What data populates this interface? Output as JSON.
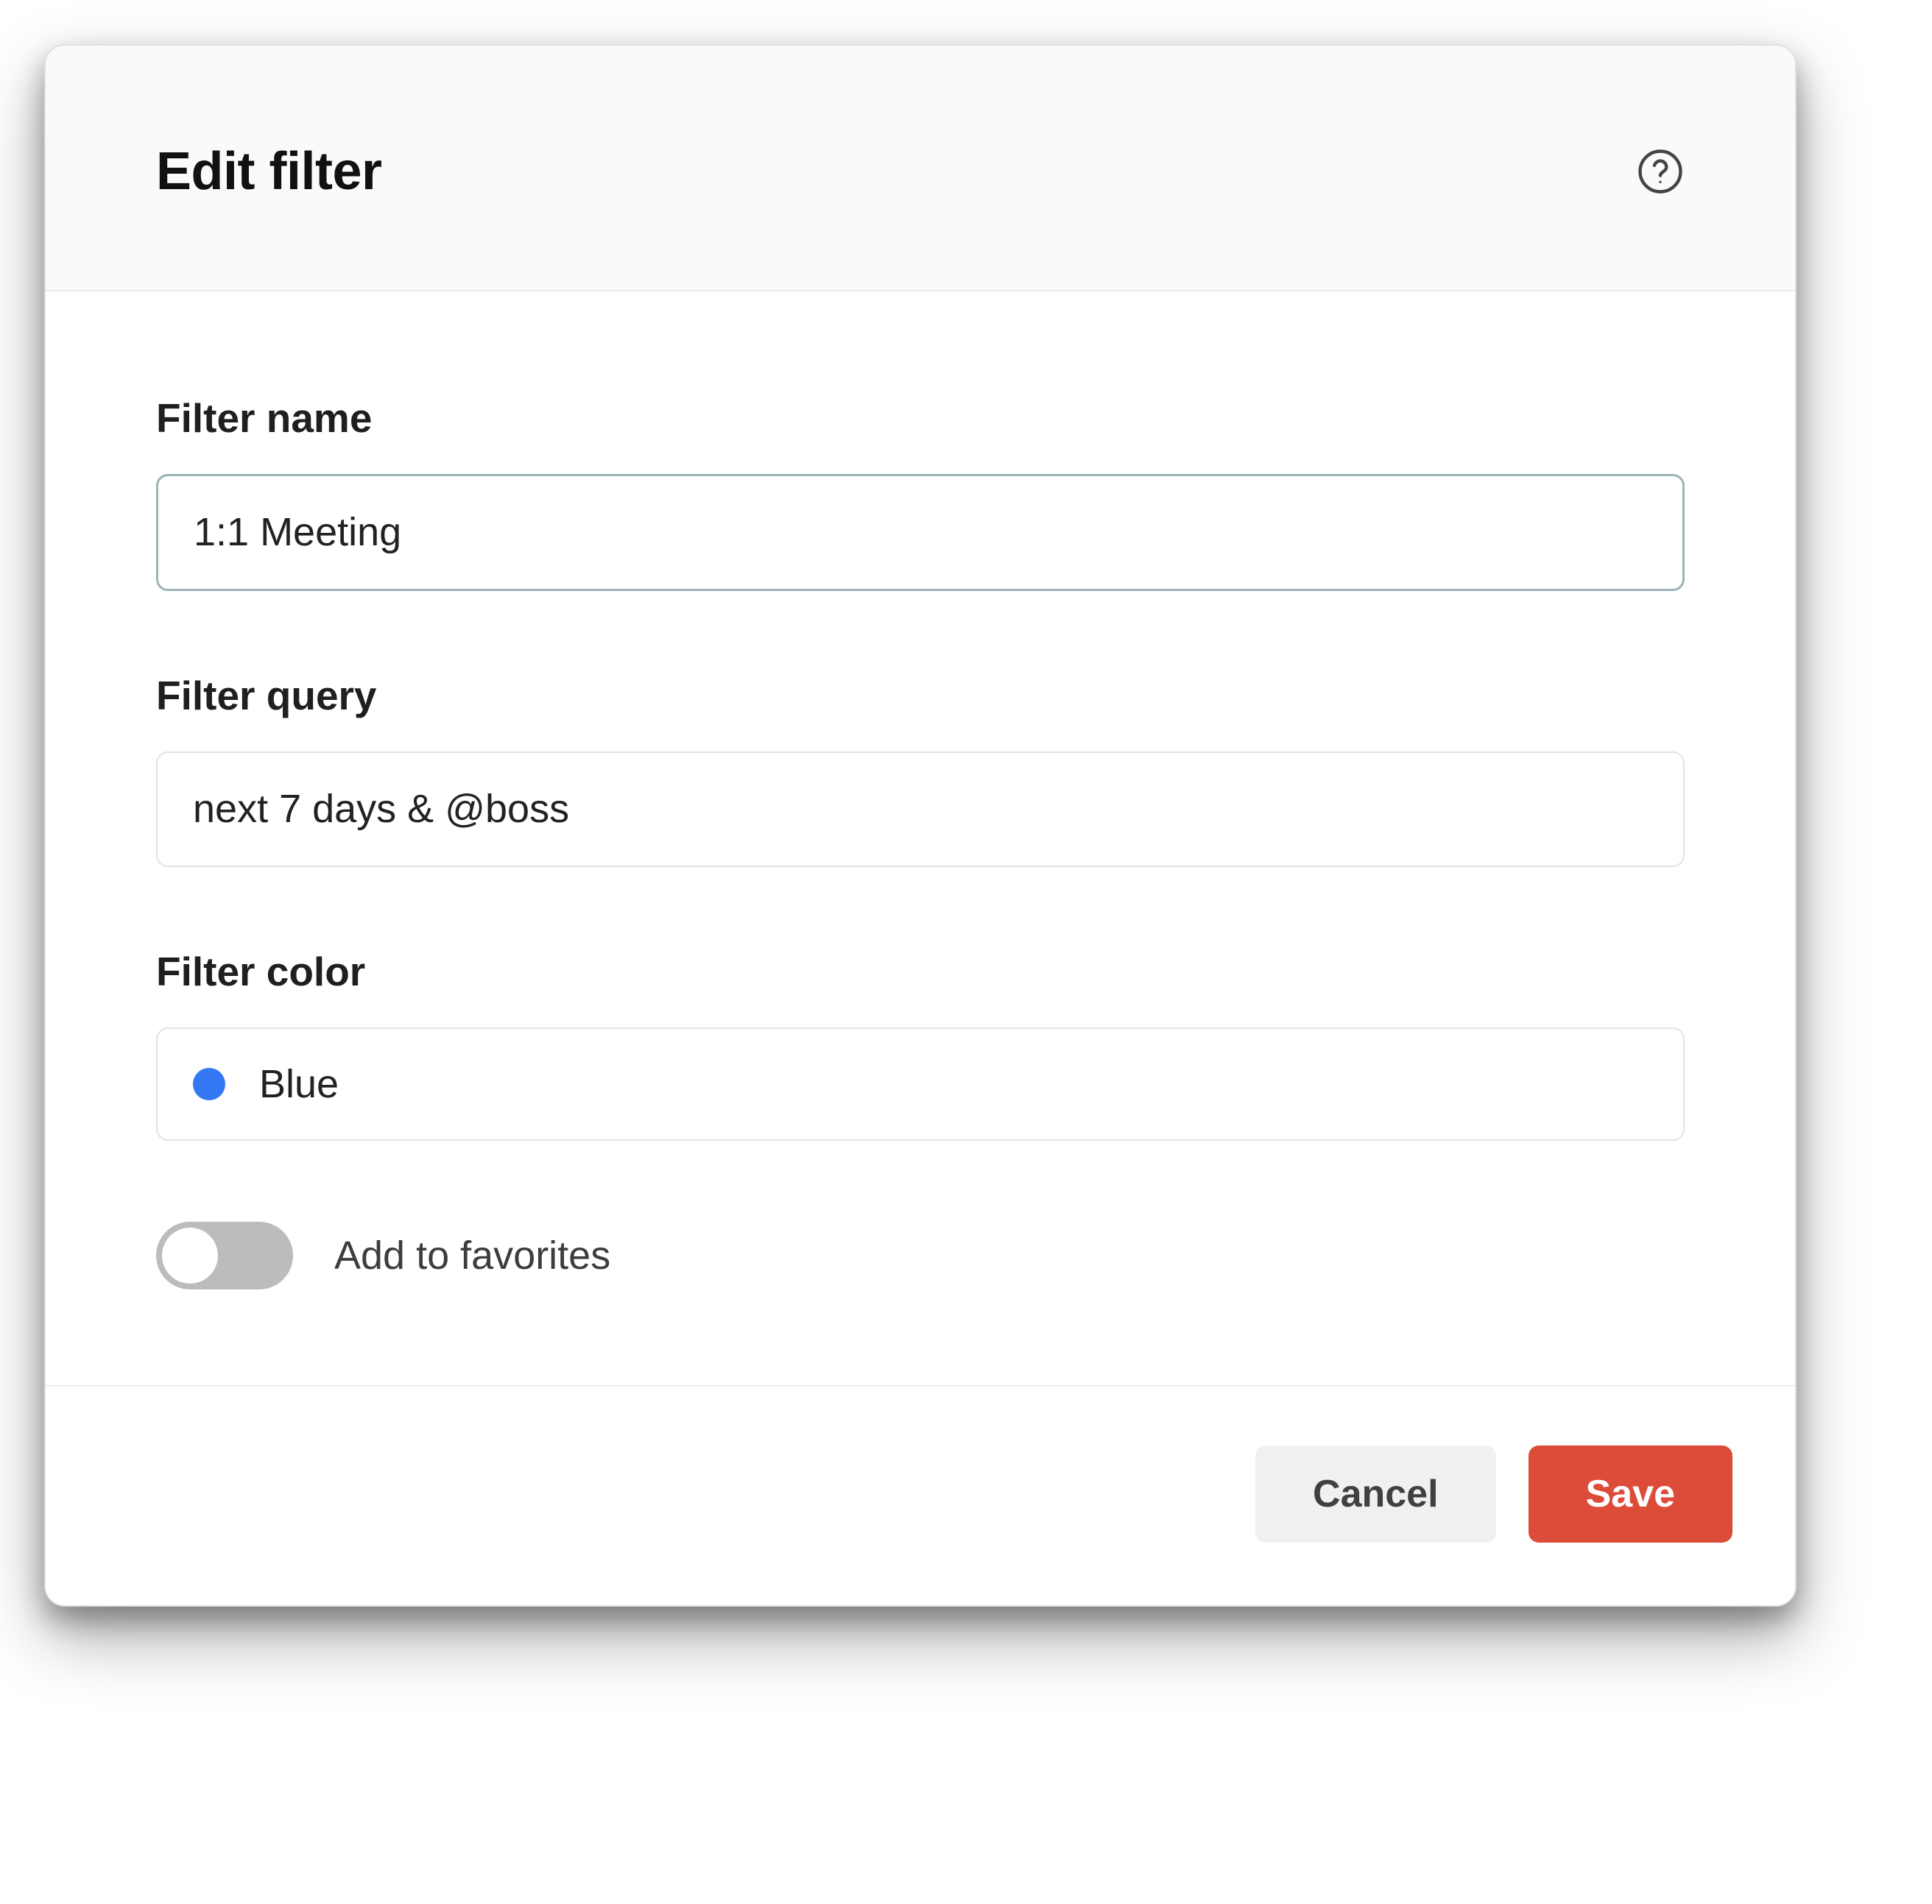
{
  "dialog": {
    "title": "Edit filter"
  },
  "fields": {
    "name_label": "Filter name",
    "name_value": "1:1 Meeting",
    "query_label": "Filter query",
    "query_value": "next 7 days & @boss",
    "color_label": "Filter color",
    "color_selected": "Blue",
    "color_hex": "#3478f6",
    "favorites_label": "Add to favorites",
    "favorites_on": false
  },
  "footer": {
    "cancel_label": "Cancel",
    "save_label": "Save"
  }
}
